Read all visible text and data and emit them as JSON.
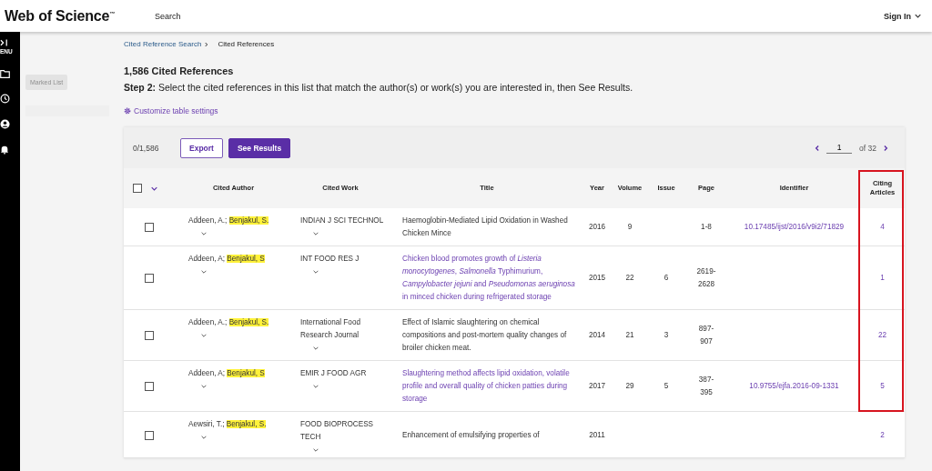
{
  "header": {
    "logo": "Web of Science$^{™}$",
    "nav": "Search",
    "sign_in": "Sign In"
  },
  "sidebar": {
    "menu_label": "ENU"
  },
  "side_panel": {
    "marked_list": "Marked List"
  },
  "breadcrumb": [
    {
      "label": "Cited Reference Search",
      "link": true
    },
    {
      "label": "Cited References",
      "link": false
    }
  ],
  "heading": "1,586 Cited References",
  "instruction": "**Step 2:** Select the cited references in this list that match the author(s) or work(s) you are interested in, then See Results.",
  "customize_link": "Customize table settings",
  "toolbar": {
    "selected_count": "0/1,586",
    "export": "Export",
    "see_results": "See Results",
    "page": "1",
    "page_total": "of 32"
  },
  "select_all": {
    "checked": false
  },
  "citing_column_framed": true,
  "columns": [
    "Cited Author",
    "Cited Work",
    "Title",
    "Year",
    "Volume",
    "Issue",
    "Page",
    "Identifier",
    "Citing Articles"
  ],
  "rows": [
    {
      "checked": false,
      "authors": [
        {
          "name": "Addeen, A.;",
          "highlighted": false
        },
        {
          "name": "Benjakul, S.",
          "highlighted": true
        }
      ],
      "work": "INDIAN J SCI TECHNOL",
      "title": "Haemoglobin-Mediated Lipid Oxidation in Washed Chicken Mince",
      "title_linked": false,
      "year": "2016",
      "volume": "9",
      "issue": "",
      "page": "1-8",
      "identifier": "10.17485/ijst/2016/v9i2/71829",
      "citing": "4"
    },
    {
      "checked": false,
      "authors": [
        {
          "name": "Addeen, A;",
          "highlighted": false
        },
        {
          "name": "Benjakul, S",
          "highlighted": true
        }
      ],
      "work": "INT FOOD RES J",
      "title": "Chicken blood promotes growth of *Listeria monocytogenes*, *Salmonella* Typhimurium, *Campylobacter jejuni* and *Pseudomonas aeruginosa* in minced chicken during refrigerated storage",
      "title_linked": true,
      "year": "2015",
      "volume": "22",
      "issue": "6",
      "page": "2619-2628",
      "identifier": "",
      "citing": "1"
    },
    {
      "checked": false,
      "authors": [
        {
          "name": "Addeen, A.;",
          "highlighted": false
        },
        {
          "name": "Benjakul, S.",
          "highlighted": true
        }
      ],
      "work": "International Food Research Journal",
      "title": "Effect of Islamic slaughtering on chemical compositions and post-mortem quality changes of broiler chicken meat.",
      "title_linked": false,
      "year": "2014",
      "volume": "21",
      "issue": "3",
      "page": "897-907",
      "identifier": "",
      "citing": "22"
    },
    {
      "checked": false,
      "authors": [
        {
          "name": "Addeen, A;",
          "highlighted": false
        },
        {
          "name": "Benjakul, S",
          "highlighted": true
        }
      ],
      "work": "EMIR J FOOD AGR",
      "title": "Slaughtering method affects lipid oxidation, volatile profile and overall quality of chicken patties during storage",
      "title_linked": true,
      "year": "2017",
      "volume": "29",
      "issue": "5",
      "page": "387-395",
      "identifier": "10.9755/ejfa.2016-09-1331",
      "citing": "5"
    },
    {
      "checked": false,
      "authors": [
        {
          "name": "Aewsiri, T.;",
          "highlighted": false
        },
        {
          "name": "Benjakul, S.",
          "highlighted": true
        }
      ],
      "work": "FOOD BIOPROCESS TECH",
      "title": "Enhancement of emulsifying properties of",
      "title_linked": false,
      "year": "2011",
      "volume": "",
      "issue": "",
      "page": "",
      "identifier": "",
      "citing": "2"
    }
  ]
}
